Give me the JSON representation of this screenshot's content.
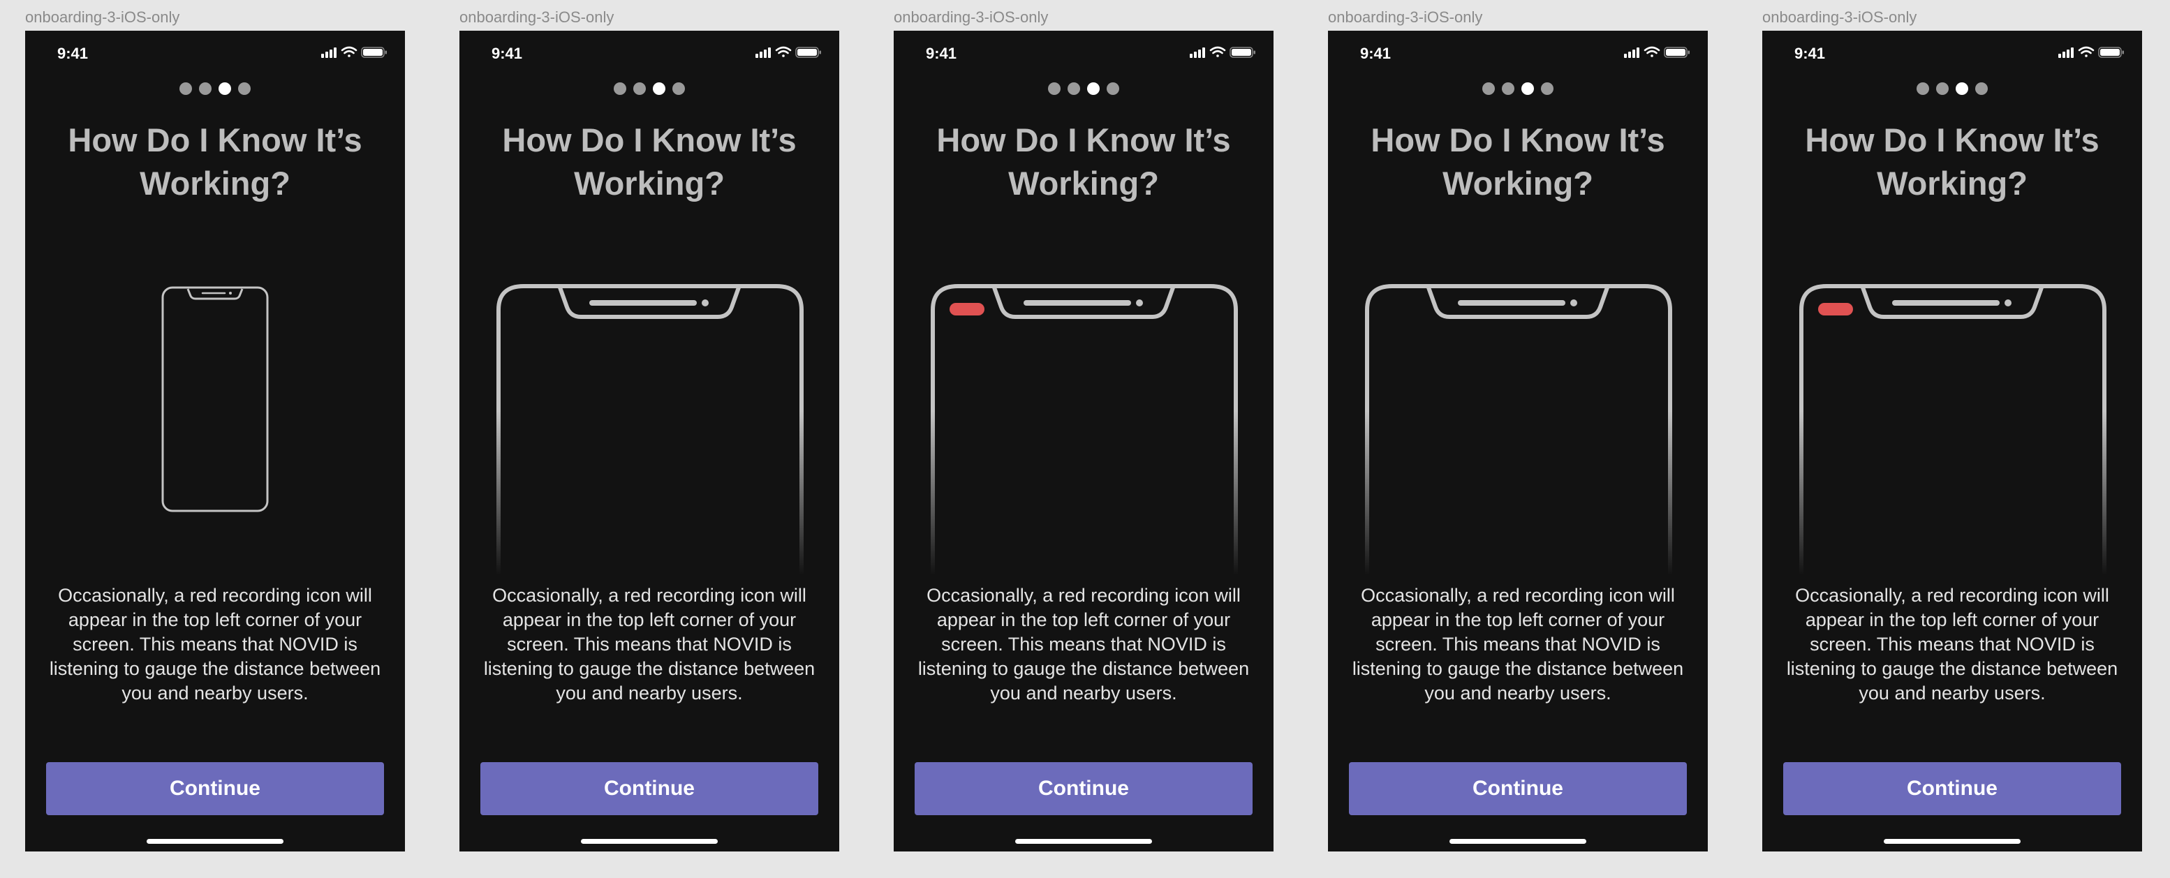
{
  "colors": {
    "canvas": "#e6e6e6",
    "screen_bg": "#121212",
    "title": "#bdbdbd",
    "body_text": "#e4e4e4",
    "button": "#6c6bbb",
    "phone_outline": "#c4c4c4",
    "recording_indicator": "#e05252",
    "dot_inactive": "#9a9a9a",
    "dot_active": "#ffffff"
  },
  "frames": [
    {
      "label": "onboarding-3-iOS-only",
      "time": "9:41",
      "active_dot": 3,
      "title": "How Do I Know It’s\nWorking?",
      "illustration": "phone-small",
      "recording_indicator": false,
      "body": "Occasionally, a red recording icon will appear in the top left corner of your screen. This means that NOVID is listening to gauge the distance between you and nearby users.",
      "button": "Continue"
    },
    {
      "label": "onboarding-3-iOS-only",
      "time": "9:41",
      "active_dot": 3,
      "title": "How Do I Know It’s\nWorking?",
      "illustration": "phone-zoom",
      "recording_indicator": false,
      "body": "Occasionally, a red recording icon will appear in the top left corner of your screen. This means that NOVID is listening to gauge the distance between you and nearby users.",
      "button": "Continue"
    },
    {
      "label": "onboarding-3-iOS-only",
      "time": "9:41",
      "active_dot": 3,
      "title": "How Do I Know It’s\nWorking?",
      "illustration": "phone-zoom",
      "recording_indicator": true,
      "body": "Occasionally, a red recording icon will appear in the top left corner of your screen. This means that NOVID is listening to gauge the distance between you and nearby users.",
      "button": "Continue"
    },
    {
      "label": "onboarding-3-iOS-only",
      "time": "9:41",
      "active_dot": 3,
      "title": "How Do I Know It’s\nWorking?",
      "illustration": "phone-zoom",
      "recording_indicator": false,
      "body": "Occasionally, a red recording icon will appear in the top left corner of your screen. This means that NOVID is listening to gauge the distance between you and nearby users.",
      "button": "Continue"
    },
    {
      "label": "onboarding-3-iOS-only",
      "time": "9:41",
      "active_dot": 3,
      "title": "How Do I Know It’s\nWorking?",
      "illustration": "phone-zoom",
      "recording_indicator": true,
      "body": "Occasionally, a red recording icon will appear in the top left corner of your screen. This means that NOVID is listening to gauge the distance between you and nearby users.",
      "button": "Continue"
    }
  ]
}
